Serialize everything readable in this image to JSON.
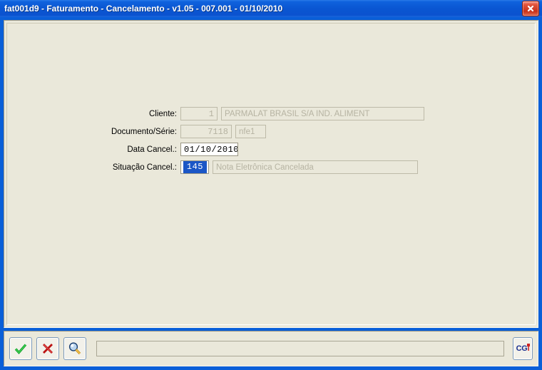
{
  "window": {
    "title": "fat001d9 - Faturamento - Cancelamento - v1.05 - 007.001 - 01/10/2010",
    "close_label": "close-icon"
  },
  "form": {
    "rows": [
      {
        "label": "Cliente:",
        "code": "1",
        "description": "PARMALAT BRASIL S/A IND. ALIMENT"
      },
      {
        "label": "Documento/Série:",
        "code": "7118",
        "description": "nfe1"
      },
      {
        "label": "Data Cancel.:",
        "code": "01/10/2010",
        "description": ""
      },
      {
        "label": "Situação Cancel.:",
        "code": "145",
        "description": "Nota Eletrônica Cancelada"
      }
    ]
  },
  "toolbar": {
    "confirm_label": "check-icon",
    "cancel_label": "x-icon",
    "search_label": "magnifier-icon",
    "status_value": "",
    "status_placeholder": "",
    "brand_cg": "CG",
    "brand_i": "i"
  },
  "colors": {
    "titlebar": "#0a56d2",
    "panel": "#eae8da",
    "selection": "#1b56c6",
    "disabled_text": "#b6b3a2",
    "close_button": "#c8321b"
  }
}
